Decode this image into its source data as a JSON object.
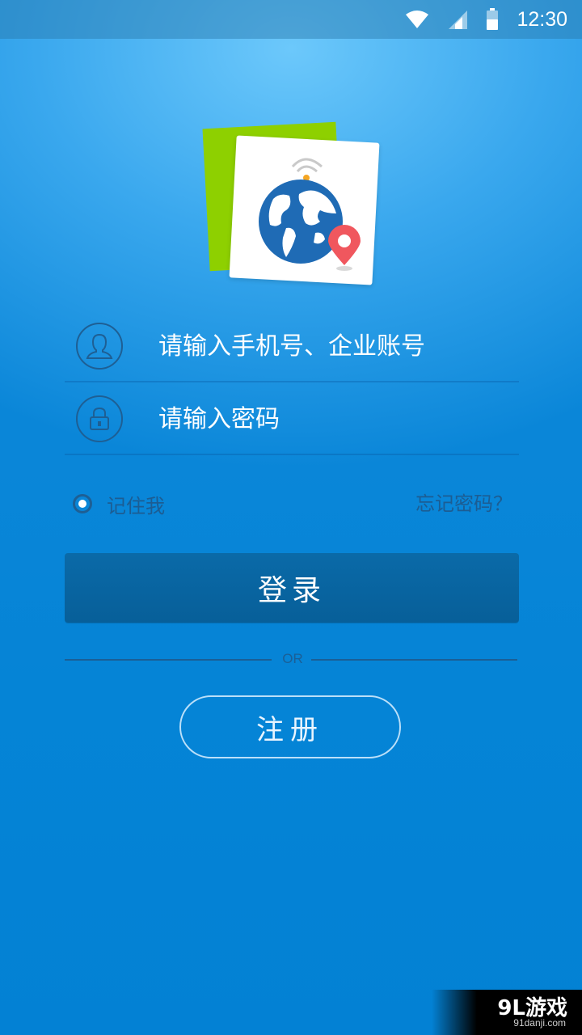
{
  "status_bar": {
    "time": "12:30",
    "icons": [
      "wifi-icon",
      "cell-signal-icon",
      "battery-icon"
    ]
  },
  "logo": {
    "icon": "globe-location-logo",
    "colors": {
      "back_card": "#8ed000",
      "globe": "#1f6bb5",
      "pin": "#f0575e"
    }
  },
  "login_form": {
    "username": {
      "placeholder": "请输入手机号、企业账号",
      "value": "",
      "icon": "user-icon"
    },
    "password": {
      "placeholder": "请输入密码",
      "value": "",
      "icon": "lock-icon"
    },
    "remember_label": "记住我",
    "remember_checked": true,
    "forgot_label": "忘记密码？",
    "login_label": "登录",
    "divider_label": "OR",
    "register_label": "注册"
  },
  "watermark": {
    "logo": "9L游戏",
    "site": "91danji.com"
  },
  "colors": {
    "background_top": "#6cc8fb",
    "background_bottom": "#0381d4",
    "button": "#0a6aa8",
    "dark_text": "#1c5d93"
  }
}
